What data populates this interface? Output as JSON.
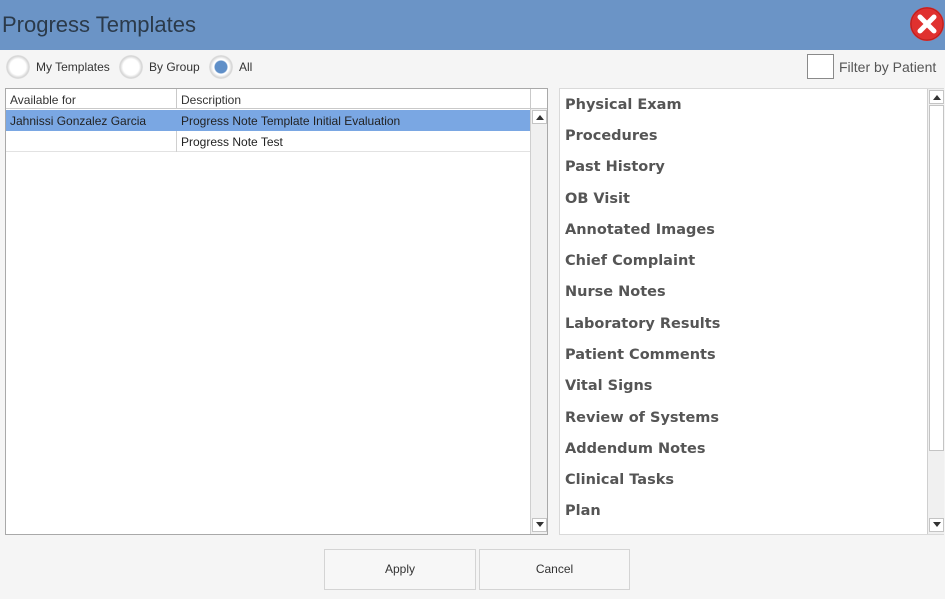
{
  "window": {
    "title": "Progress Templates",
    "close_icon": "close-icon",
    "accent_color": "#6b94c6",
    "close_color": "#e0312f"
  },
  "filters": {
    "radios": [
      {
        "label": "My Templates",
        "checked": false
      },
      {
        "label": "By Group",
        "checked": false
      },
      {
        "label": "All",
        "checked": true
      }
    ],
    "filter_by_patient": {
      "label": "Filter by Patient",
      "checked": false
    }
  },
  "templates_table": {
    "columns": [
      "Available for",
      "Description"
    ],
    "rows": [
      {
        "available_for": "Jahnissi Gonzalez Garcia",
        "description": "Progress Note Template Initial Evaluation",
        "selected": true
      },
      {
        "available_for": "",
        "description": "Progress Note Test",
        "selected": false
      }
    ],
    "selection_color": "#7aa7e3"
  },
  "sections": {
    "items": [
      "Physical Exam",
      "Procedures",
      "Past History",
      "OB Visit",
      "Annotated Images",
      "Chief Complaint",
      "Nurse Notes",
      "Laboratory Results",
      "Patient Comments",
      "Vital Signs",
      "Review of Systems",
      "Addendum Notes",
      "Clinical Tasks",
      "Plan"
    ]
  },
  "buttons": {
    "apply": "Apply",
    "cancel": "Cancel"
  }
}
